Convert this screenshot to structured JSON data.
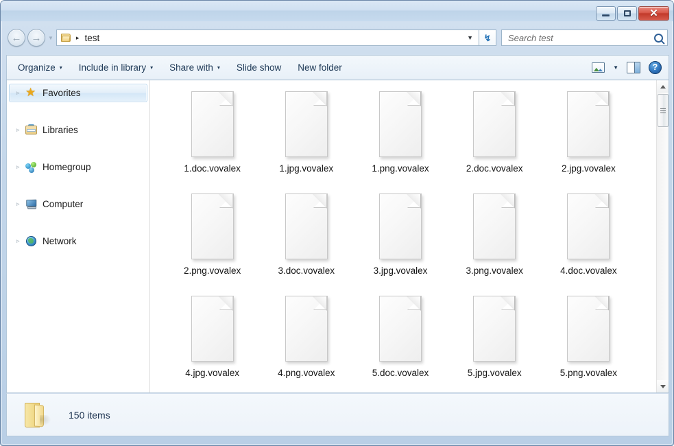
{
  "window": {
    "title": "",
    "controls": {
      "minimize_label": "Minimize",
      "maximize_label": "Maximize",
      "close_label": "✕"
    }
  },
  "navigation": {
    "back_label": "←",
    "forward_label": "→",
    "recent_caret": "▾",
    "refresh_label": "↺"
  },
  "address": {
    "folder_icon": "folder-icon",
    "separator": "▸",
    "path": "test",
    "dropdown_caret": "▼"
  },
  "search": {
    "placeholder": "Search test",
    "value": "",
    "icon": "search-icon"
  },
  "toolbar": {
    "items": [
      {
        "label": "Organize",
        "has_caret": true
      },
      {
        "label": "Include in library",
        "has_caret": true
      },
      {
        "label": "Share with",
        "has_caret": true
      },
      {
        "label": "Slide show",
        "has_caret": false
      },
      {
        "label": "New folder",
        "has_caret": false
      }
    ],
    "caret": "▾",
    "change_view_icon": "change-view-icon",
    "view_caret": "▼",
    "preview_pane_icon": "preview-pane-icon",
    "help_icon": "help-icon",
    "help_label": "?"
  },
  "sidebar": {
    "items": [
      {
        "label": "Favorites",
        "icon": "star-icon",
        "selected": true,
        "expander": "▹"
      },
      {
        "label": "Libraries",
        "icon": "libraries-icon",
        "selected": false,
        "expander": "▹"
      },
      {
        "label": "Homegroup",
        "icon": "homegroup-icon",
        "selected": false,
        "expander": "▹"
      },
      {
        "label": "Computer",
        "icon": "computer-icon",
        "selected": false,
        "expander": "▹"
      },
      {
        "label": "Network",
        "icon": "network-icon",
        "selected": false,
        "expander": "▹"
      }
    ]
  },
  "files": [
    {
      "name": "1.doc.vovalex",
      "icon": "blank-document-icon"
    },
    {
      "name": "1.jpg.vovalex",
      "icon": "blank-document-icon"
    },
    {
      "name": "1.png.vovalex",
      "icon": "blank-document-icon"
    },
    {
      "name": "2.doc.vovalex",
      "icon": "blank-document-icon"
    },
    {
      "name": "2.jpg.vovalex",
      "icon": "blank-document-icon"
    },
    {
      "name": "2.png.vovalex",
      "icon": "blank-document-icon"
    },
    {
      "name": "3.doc.vovalex",
      "icon": "blank-document-icon"
    },
    {
      "name": "3.jpg.vovalex",
      "icon": "blank-document-icon"
    },
    {
      "name": "3.png.vovalex",
      "icon": "blank-document-icon"
    },
    {
      "name": "4.doc.vovalex",
      "icon": "blank-document-icon"
    },
    {
      "name": "4.jpg.vovalex",
      "icon": "blank-document-icon"
    },
    {
      "name": "4.png.vovalex",
      "icon": "blank-document-icon"
    },
    {
      "name": "5.doc.vovalex",
      "icon": "blank-document-icon"
    },
    {
      "name": "5.jpg.vovalex",
      "icon": "blank-document-icon"
    },
    {
      "name": "5.png.vovalex",
      "icon": "blank-document-icon"
    }
  ],
  "scrollbar": {
    "up_arrow": "▲",
    "down_arrow": "▼"
  },
  "statusbar": {
    "folder_icon": "open-folder-icon",
    "item_count_text": "150 items"
  },
  "colors": {
    "frame": "#b9cfe6",
    "accent": "#2f74bd",
    "close_button": "#c23a2b",
    "selection": "#d4e7f7",
    "folder_yellow": "#f2d98c",
    "text": "#1c3350"
  }
}
